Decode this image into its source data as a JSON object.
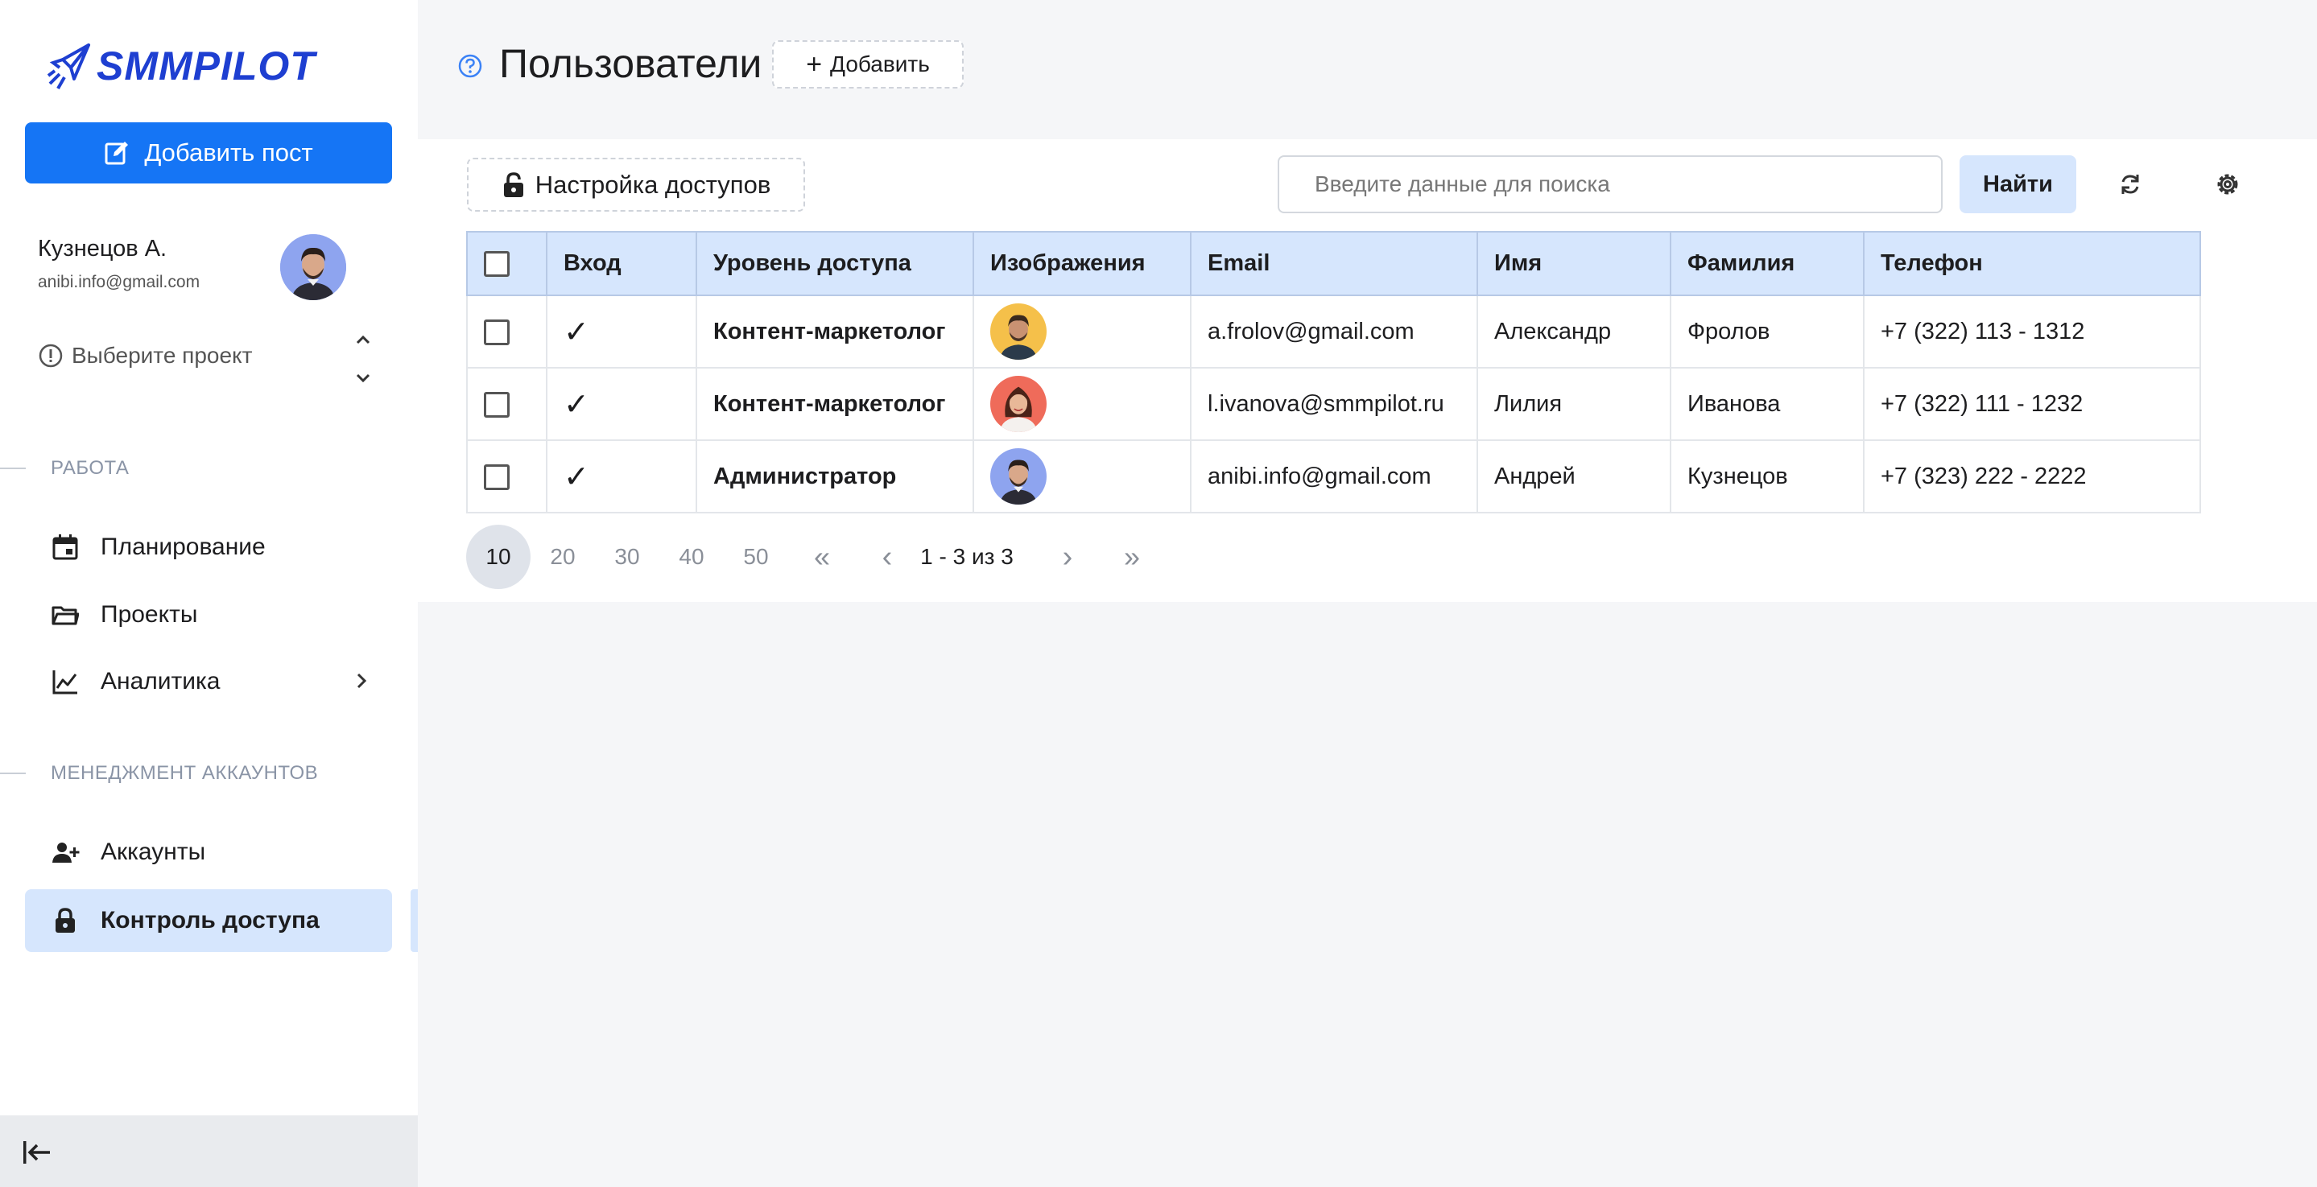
{
  "brand": {
    "name": "SMMPILOT",
    "accent": "#1575f5",
    "logo_color": "#1e3fd1"
  },
  "sidebar": {
    "add_post_label": "Добавить пост",
    "user": {
      "name": "Кузнецов А.",
      "email": "anibi.info@gmail.com"
    },
    "project_placeholder": "Выберите проект",
    "sections": [
      {
        "label": "РАБОТА",
        "items": [
          {
            "label": "Планирование",
            "icon": "calendar-icon"
          },
          {
            "label": "Проекты",
            "icon": "folder-icon"
          },
          {
            "label": "Аналитика",
            "icon": "chart-icon"
          }
        ]
      },
      {
        "label": "МЕНЕДЖМЕНТ АККАУНТОВ",
        "items": [
          {
            "label": "Аккаунты",
            "icon": "add-user-icon"
          },
          {
            "label": "Контроль доступа",
            "icon": "lock-icon",
            "active": true
          }
        ]
      }
    ]
  },
  "header": {
    "title": "Пользователи",
    "add_label": "Добавить"
  },
  "toolbar": {
    "access_settings_label": "Настройка доступов",
    "search_placeholder": "Введите данные для поиска",
    "find_label": "Найти"
  },
  "table": {
    "columns": [
      "Вход",
      "Уровень доступа",
      "Изображения",
      "Email",
      "Имя",
      "Фамилия",
      "Телефон"
    ],
    "rows": [
      {
        "login": "✓",
        "level": "Контент-маркетолог",
        "avatar_bg": "#f5c04a",
        "email": "a.frolov@gmail.com",
        "first": "Александр",
        "last": "Фролов",
        "phone": "+7 (322) 113 - 1312"
      },
      {
        "login": "✓",
        "level": "Контент-маркетолог",
        "avatar_bg": "#ef6b5a",
        "email": "l.ivanova@smmpilot.ru",
        "first": "Лилия",
        "last": "Иванова",
        "phone": "+7 (322) 111 - 1232"
      },
      {
        "login": "✓",
        "level": "Администратор",
        "avatar_bg": "#8ea4ef",
        "email": "anibi.info@gmail.com",
        "first": "Андрей",
        "last": "Кузнецов",
        "phone": "+7 (323) 222 - 2222"
      }
    ]
  },
  "pagination": {
    "sizes": [
      "10",
      "20",
      "30",
      "40",
      "50"
    ],
    "active_size": "10",
    "first": "«",
    "prev": "‹",
    "range": "1 - 3 из 3",
    "next": "›",
    "last": "»"
  }
}
